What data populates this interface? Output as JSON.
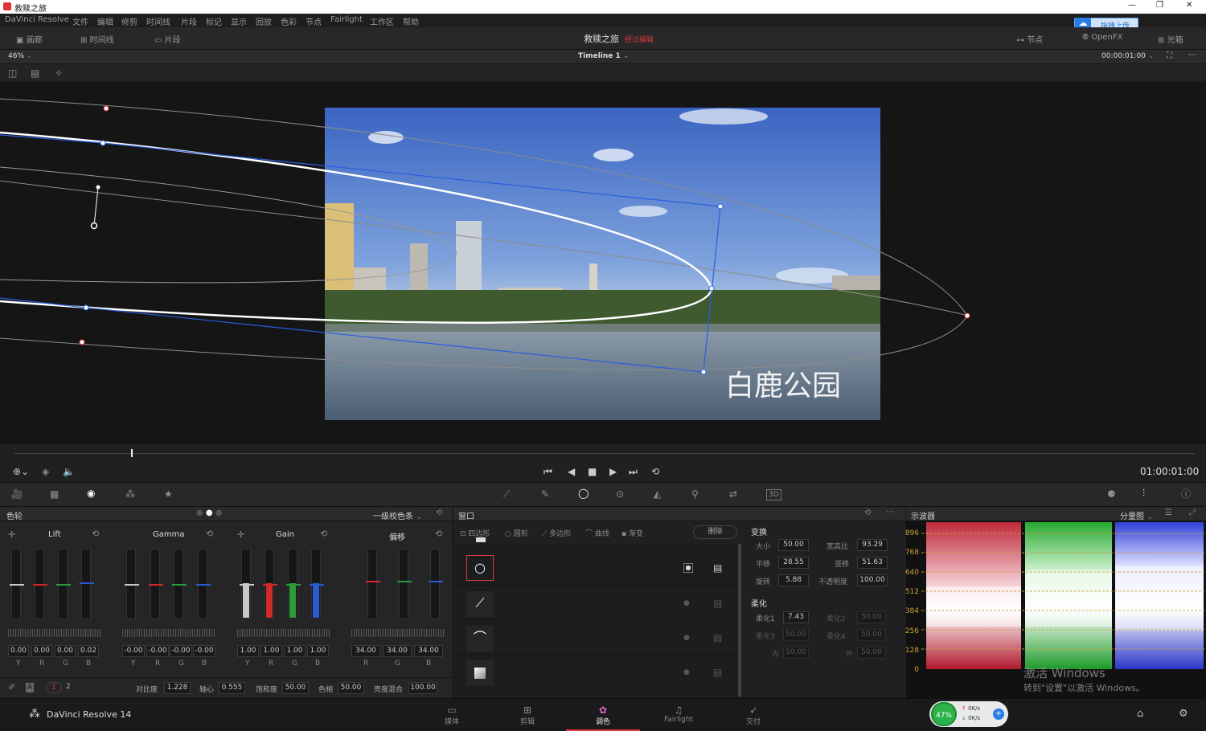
{
  "window": {
    "title": "救赎之旅",
    "min": "—",
    "restore": "❐",
    "close": "✕"
  },
  "menu": [
    "DaVinci Resolve",
    "文件",
    "编辑",
    "修剪",
    "时间线",
    "片段",
    "标记",
    "显示",
    "回放",
    "色彩",
    "节点",
    "Fairlight",
    "工作区",
    "帮助"
  ],
  "pagebar": {
    "left": [
      {
        "icon": "media-pool-icon",
        "label": "画廊"
      },
      {
        "icon": "timeline-icon",
        "label": "时间线"
      },
      {
        "icon": "clip-icon",
        "label": "片段"
      }
    ],
    "project": "救赎之旅",
    "status": "经过编辑",
    "right": [
      {
        "icon": "nodes-icon",
        "label": "节点"
      },
      {
        "icon": "openfx-icon",
        "label": "OpenFX"
      },
      {
        "icon": "lightbox-icon",
        "label": "光箱"
      }
    ],
    "upload_button": "拖拽上传"
  },
  "viewerbar": {
    "zoom": "46%",
    "timeline": "Timeline 1",
    "timecode": "00:00:01:00"
  },
  "viewer": {
    "overlay_text": "白鹿公园"
  },
  "transport": {
    "timecode": "01:00:01:00"
  },
  "wheels": {
    "title": "色轮",
    "mode": "一级校色条",
    "groups": [
      {
        "name": "Lift",
        "values": [
          "0.00",
          "0.00",
          "0.00",
          "0.02"
        ],
        "channels": [
          "Y",
          "R",
          "G",
          "B"
        ],
        "levels": [
          0.5,
          0.5,
          0.5,
          0.52
        ]
      },
      {
        "name": "Gamma",
        "values": [
          "-0.00",
          "-0.00",
          "-0.00",
          "-0.00"
        ],
        "channels": [
          "Y",
          "R",
          "G",
          "B"
        ],
        "levels": [
          0.5,
          0.5,
          0.5,
          0.5
        ]
      },
      {
        "name": "Gain",
        "values": [
          "1.00",
          "1.00",
          "1.00",
          "1.00"
        ],
        "channels": [
          "Y",
          "R",
          "G",
          "B"
        ],
        "levels": [
          0.5,
          0.5,
          0.5,
          0.5
        ]
      },
      {
        "name": "偏移",
        "values": [
          "34.00",
          "34.00",
          "34.00"
        ],
        "channels": [
          "R",
          "G",
          "B"
        ],
        "levels": [
          0.55,
          0.55,
          0.55
        ]
      }
    ],
    "footer": {
      "page1": "1",
      "page2": "2",
      "contrast_label": "对比度",
      "contrast": "1.228",
      "pivot_label": "轴心",
      "pivot": "0.555",
      "sat_label": "饱和度",
      "sat": "50.00",
      "hue_label": "色相",
      "hue": "50.00",
      "lum_label": "亮度混合",
      "lum": "100.00"
    }
  },
  "window_panel": {
    "title": "窗口",
    "tools": [
      "四边形",
      "圆形",
      "多边形",
      "曲线",
      "渐变"
    ],
    "delete": "删除"
  },
  "transform": {
    "title": "变换",
    "size_label": "大小",
    "size": "50.00",
    "aspect_label": "宽高比",
    "aspect": "93.29",
    "pan_label": "平移",
    "pan": "28.55",
    "tilt_label": "竖移",
    "tilt": "51.63",
    "rotate_label": "旋转",
    "rotate": "5.88",
    "opacity_label": "不透明度",
    "opacity": "100.00",
    "soft_title": "柔化",
    "soft1_label": "柔化1",
    "soft1": "7.43",
    "soft2_label": "柔化2",
    "soft2": "50.00",
    "soft3_label": "柔化3",
    "soft3": "50.00",
    "soft4_label": "柔化4",
    "soft4": "50.00",
    "inner_label": "内",
    "inner": "50.00",
    "outer_label": "外",
    "outer": "50.00"
  },
  "scope": {
    "title": "示波器",
    "mode": "分量图",
    "ticks": [
      "896",
      "768",
      "640",
      "512",
      "384",
      "256",
      "128",
      "0"
    ],
    "watermark1": "激活 Windows",
    "watermark2": "转到\"设置\"以激活 Windows。"
  },
  "bottom": {
    "app": "DaVinci Resolve 14",
    "tabs": [
      "媒体",
      "剪辑",
      "调色",
      "Fairlight",
      "交付"
    ],
    "active_tab": "调色",
    "meter": "47%",
    "net_up": "0K/s",
    "net_down": "0K/s"
  },
  "colors": {
    "accent": "#e0353b",
    "blue": "#2a6ee0",
    "scope_red": "#d8364a",
    "scope_green": "#2fc43a",
    "scope_blue": "#4c5cf0"
  }
}
